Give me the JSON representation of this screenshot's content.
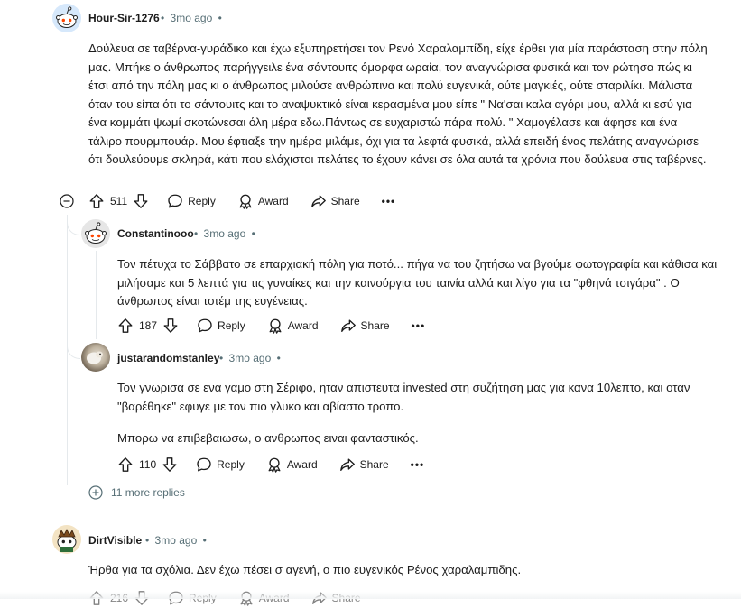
{
  "comments": [
    {
      "author": "Hour-Sir-1276",
      "time": "3mo ago",
      "body": [
        "Δούλευα σε ταβέρνα-γυράδικο και έχω εξυπηρετήσει τον Ρενό Χαραλαμπίδη, είχε έρθει για μία παράσταση στην πόλη μας. Μπήκε ο άνθρωπος παρήγγειλε ένα σάντουιτς όμορφα ωραία, τον αναγνώρισα φυσικά και τον ρώτησα πώς κι έτσι από την πόλη μας κι ο άνθρωπος μιλούσε ανθρώπινα και πολύ ευγενικά, ούτε μαγκιές, ούτε σταριλίκι. Μάλιστα όταν του είπα ότι το σάντουιτς και το αναψυκτικό είναι κερασμένα μου είπε \" Να'σαι καλα αγόρι μου, αλλά κι εσύ για ένα κομμάτι ψωμί σκοτώνεσαι όλη μέρα εδω.Πάντως σε ευχαριστώ πάρα πολύ. \" Χαμογέλασε και άφησε και ένα τάλιρο πουρμπουάρ. Μου έφτιαξε την ημέρα μιλάμε, όχι για τα λεφτά φυσικά, αλλά επειδή ένας πελάτης αναγνώρισε ότι δουλεύουμε σκληρά, κάτι που ελάχιστοι πελάτες το έχουν κάνει σε όλα αυτά τα χρόνια που δούλευα στις ταβέρνες."
      ],
      "votes": "511"
    },
    {
      "author": "Constantinooo",
      "time": "3mo ago",
      "body": [
        "Τον πέτυχα το Σάββατο σε επαρχιακή πόλη για ποτό... πήγα να του ζητήσω να βγούμε φωτογραφία και κάθισα και μιλήσαμε και 5 λεπτά για τις γυναίκες και την καινούργια του ταινία αλλά και λίγο για τα \"φθηνά τσιγάρα\" . Ο άνθρωπος είναι τοτέμ της ευγένειας."
      ],
      "votes": "187"
    },
    {
      "author": "justarandomstanley",
      "time": "3mo ago",
      "body": [
        "Τον γνωρισα σε ενα γαμο στη Σέριφο, ηταν απιστευτα invested στη συζήτηση μας για κανα 10λεπτο, και οταν \"βαρέθηκε\" εφυγε με τον πιο γλυκο και αβίαστο τροπο.",
        "Μπορω να επιβεβαιωσω, ο ανθρωπος ειναι φανταστικός."
      ],
      "votes": "110"
    },
    {
      "author": "DirtVisible",
      "time": "3mo ago",
      "body": [
        "Ήρθα για τα σχόλια. Δεν έχω πέσει σ αγενή, ο πιο ευγενικός Ρένος χαραλαμπιδης."
      ],
      "votes": "216"
    }
  ],
  "labels": {
    "reply": "Reply",
    "award": "Award",
    "share": "Share",
    "dot": "•",
    "more_dots": "•••",
    "more_replies": "11 more replies"
  },
  "icons": {
    "upvote": "upvote-arrow-icon",
    "downvote": "downvote-arrow-icon",
    "reply": "speech-bubble-icon",
    "award": "award-ribbon-icon",
    "share": "share-arrow-icon",
    "collapse": "minus-circle-icon",
    "expand": "plus-circle-icon"
  },
  "colors": {
    "text": "#1c1c1c",
    "meta": "#576f76",
    "thread": "#e5e9ec",
    "snoo_bg_blue": "#d6e8fb",
    "snoo_bg_gray": "#e6e6e6"
  }
}
